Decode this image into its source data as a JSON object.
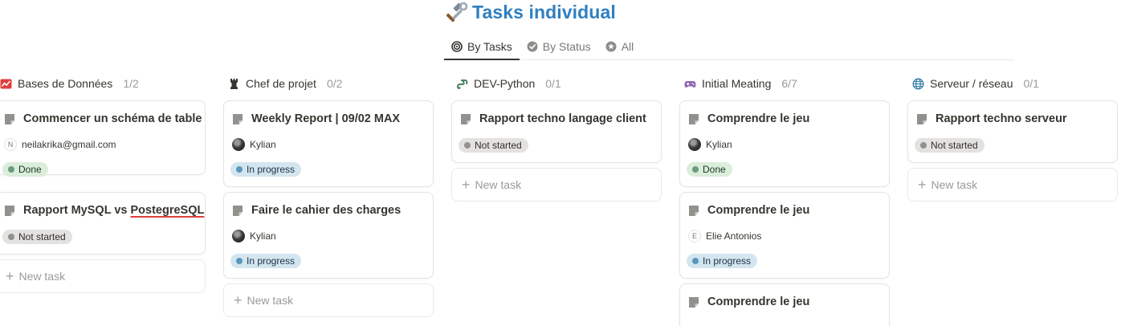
{
  "page": {
    "title": "Tasks individual",
    "title_icon": "hammer-and-wrench-icon",
    "accent_color": "#2f7fc1"
  },
  "tabs": [
    {
      "label": "By Tasks",
      "icon": "target-icon",
      "active": true
    },
    {
      "label": "By Status",
      "icon": "check-circle-icon",
      "active": false
    },
    {
      "label": "All",
      "icon": "star-circle-icon",
      "active": false
    }
  ],
  "columns": [
    {
      "name": "Bases de Données",
      "count": "1/2",
      "icon": "chart-icon",
      "cards": [
        {
          "title": "Commencer un schéma de table",
          "assignee": "neilakrika@gmail.com",
          "assignee_initial": "N",
          "status": "Done"
        },
        {
          "title_pre": "Rapport MySQL vs ",
          "title_marked": "PostegreSQL",
          "status": "Not started"
        }
      ],
      "new_task": "New task"
    },
    {
      "name": "Chef de projet",
      "count": "0/2",
      "icon": "chess-rook-icon",
      "cards": [
        {
          "title": "Weekly Report | 09/02 MAX",
          "assignee": "Kylian",
          "status": "In progress"
        },
        {
          "title": "Faire le cahier des charges",
          "assignee": "Kylian",
          "status": "In progress"
        }
      ],
      "new_task": "New task"
    },
    {
      "name": "DEV-Python",
      "count": "0/1",
      "icon": "python-icon",
      "cards": [
        {
          "title": "Rapport techno langage client",
          "status": "Not started"
        }
      ],
      "new_task": "New task"
    },
    {
      "name": "Initial Meating",
      "count": "6/7",
      "icon": "game-controller-icon",
      "cards": [
        {
          "title": "Comprendre le jeu",
          "assignee": "Kylian",
          "status": "Done"
        },
        {
          "title": "Comprendre le jeu",
          "assignee": "Elie Antonios",
          "assignee_initial": "E",
          "status": "In progress"
        },
        {
          "title": "Comprendre le jeu"
        }
      ]
    },
    {
      "name": "Serveur / réseau",
      "count": "0/1",
      "icon": "globe-icon",
      "cards": [
        {
          "title": "Rapport techno serveur",
          "status": "Not started"
        }
      ],
      "new_task": "New task"
    }
  ]
}
